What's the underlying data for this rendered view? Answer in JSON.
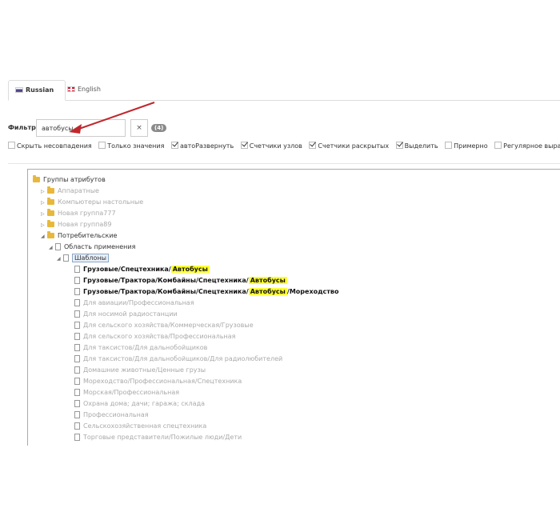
{
  "tabs": [
    {
      "label": "Russian",
      "flag": "ru-flag-icon"
    },
    {
      "label": "English",
      "flag": "uk-flag-icon"
    }
  ],
  "filter": {
    "label": "Фильтр:",
    "value": "автобусы",
    "clear_label": "×",
    "count": "(4)"
  },
  "options": [
    {
      "label": "Скрыть несовпадения",
      "checked": false
    },
    {
      "label": "Только значения",
      "checked": false
    },
    {
      "label": "автоРазвернуть",
      "checked": true
    },
    {
      "label": "Счетчики узлов",
      "checked": true
    },
    {
      "label": "Счетчики раскрытых",
      "checked": true
    },
    {
      "label": "Выделить",
      "checked": true
    },
    {
      "label": "Примерно",
      "checked": false
    },
    {
      "label": "Регулярное выражение",
      "checked": false
    }
  ],
  "tree": {
    "root": "Группы атрибутов",
    "groups": [
      "Аппаратные",
      "Компьютеры настольные",
      "Новая группа777",
      "Новая группа89"
    ],
    "expanded_group": "Потребительские",
    "sub": "Область применения",
    "selected": "Шаблоны",
    "matches": [
      {
        "prefix": "Грузовые/Спецтехника/",
        "hl": "Автобусы",
        "suffix": ""
      },
      {
        "prefix": "Грузовые/Трактора/Комбайны/Спецтехника/",
        "hl": "Автобусы",
        "suffix": ""
      },
      {
        "prefix": "Грузовые/Трактора/Комбайны/Спецтехника/",
        "hl": "Автобусы",
        "suffix": "/Мореходство"
      }
    ],
    "others": [
      "Для авиации/Профессиональная",
      "Для носимой радиостанции",
      "Для сельского хозяйства/Коммерческая/Грузовые",
      "Для сельского хозяйства/Профессиональная",
      "Для таксистов/Для дальнобойщиков",
      "Для таксистов/Для дальнобойщиков/Для радиолюбителей",
      "Домашние животные/Ценные грузы",
      "Мореходство/Профессиональная/Спецтехника",
      "Морская/Профессиональная",
      "Охрана дома; дачи; гаража; склада",
      "Профессиональная",
      "Сельскохозяйственная спецтехника",
      "Торговые представители/Пожилые люди/Дети"
    ]
  },
  "colors": {
    "highlight": "#ffff33",
    "arrow": "#c0272d",
    "folder": "#e8b83c"
  }
}
